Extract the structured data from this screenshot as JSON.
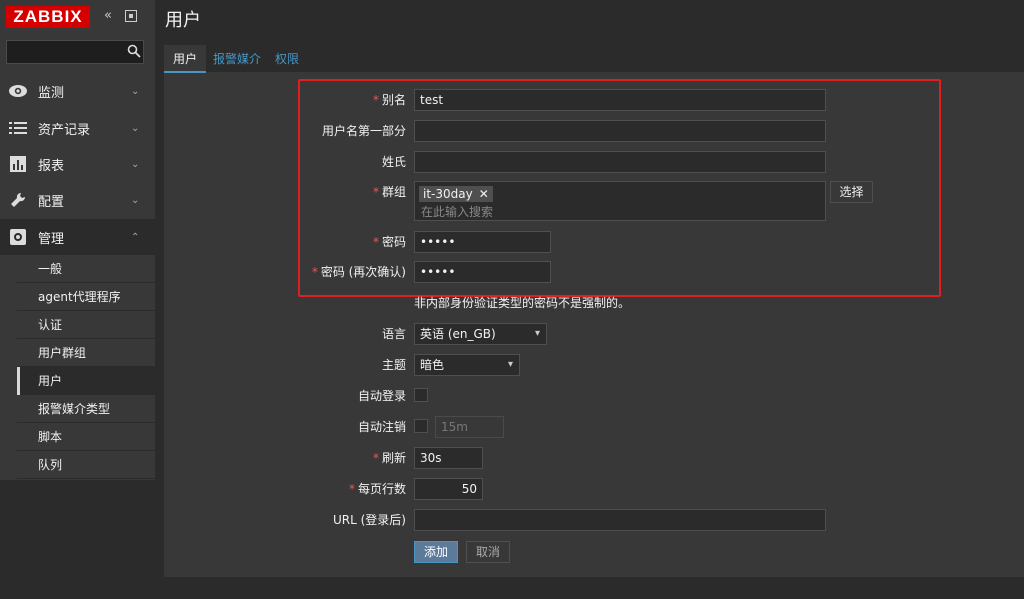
{
  "sidebar": {
    "logo": "ZABBIX",
    "menu": [
      {
        "label": "监测"
      },
      {
        "label": "资产记录"
      },
      {
        "label": "报表"
      },
      {
        "label": "配置"
      },
      {
        "label": "管理"
      }
    ],
    "submenu": [
      {
        "label": "一般"
      },
      {
        "label": "agent代理程序"
      },
      {
        "label": "认证"
      },
      {
        "label": "用户群组"
      },
      {
        "label": "用户"
      },
      {
        "label": "报警媒介类型"
      },
      {
        "label": "脚本"
      },
      {
        "label": "队列"
      }
    ]
  },
  "page": {
    "title": "用户"
  },
  "tabs": [
    {
      "label": "用户"
    },
    {
      "label": "报警媒介"
    },
    {
      "label": "权限"
    }
  ],
  "form": {
    "alias_label": "别名",
    "alias_value": "test",
    "first_name_label": "用户名第一部分",
    "first_name_value": "",
    "surname_label": "姓氏",
    "surname_value": "",
    "groups_label": "群组",
    "group_tag": "it-30day",
    "group_placeholder": "在此输入搜索",
    "select_button": "选择",
    "password_label": "密码",
    "password_value": "•••••",
    "password_confirm_label": "密码 (再次确认)",
    "password_confirm_value": "•••••",
    "password_hint": "非内部身份验证类型的密码不是强制的。",
    "language_label": "语言",
    "language_value": "英语 (en_GB)",
    "theme_label": "主题",
    "theme_value": "暗色",
    "autologin_label": "自动登录",
    "autologout_label": "自动注销",
    "autologout_value": "15m",
    "refresh_label": "刷新",
    "refresh_value": "30s",
    "rows_per_page_label": "每页行数",
    "rows_per_page_value": "50",
    "url_label": "URL (登录后)",
    "url_value": "",
    "add_button": "添加",
    "cancel_button": "取消",
    "required_marker": "*"
  },
  "colors": {
    "accent": "#4796c4",
    "brand": "#d40000",
    "highlight": "#e02020"
  }
}
